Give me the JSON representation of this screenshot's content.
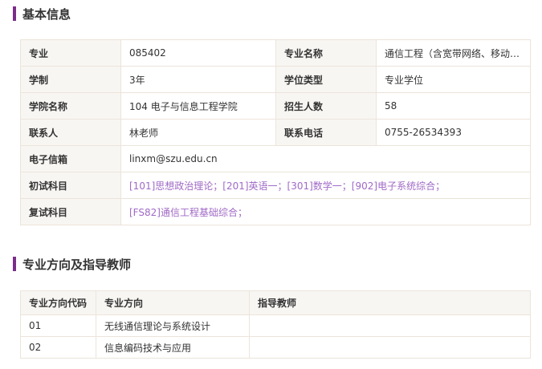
{
  "sections": {
    "basic_info_title": "基本信息",
    "directions_title": "专业方向及指导教师"
  },
  "info": {
    "major_label": "专业",
    "major_value": "085402",
    "major_name_label": "专业名称",
    "major_name_value": "通信工程（含宽带网络、移动…",
    "duration_label": "学制",
    "duration_value": "3年",
    "degree_type_label": "学位类型",
    "degree_type_value": "专业学位",
    "college_label": "学院名称",
    "college_value": "104 电子与信息工程学院",
    "enrollment_label": "招生人数",
    "enrollment_value": "58",
    "contact_label": "联系人",
    "contact_value": "林老师",
    "phone_label": "联系电话",
    "phone_value": "0755-26534393",
    "email_label": "电子信箱",
    "email_value": "linxm@szu.edu.cn",
    "initial_exam_label": "初试科目",
    "initial_exam_value": "[101]思想政治理论；[201]英语一；[301]数学一；[902]电子系统综合；",
    "retest_label": "复试科目",
    "retest_value": "[FS82]通信工程基础综合；"
  },
  "directions": {
    "headers": [
      "专业方向代码",
      "专业方向",
      "指导教师"
    ],
    "rows": [
      {
        "code": "01",
        "name": "无线通信理论与系统设计",
        "advisor": ""
      },
      {
        "code": "02",
        "name": "信息编码技术与应用",
        "advisor": ""
      }
    ]
  },
  "colors": {
    "accent": "#7b2d8b",
    "link": "#a06ac6",
    "label_bg": "#f8f6f3",
    "border": "#ece4da"
  }
}
